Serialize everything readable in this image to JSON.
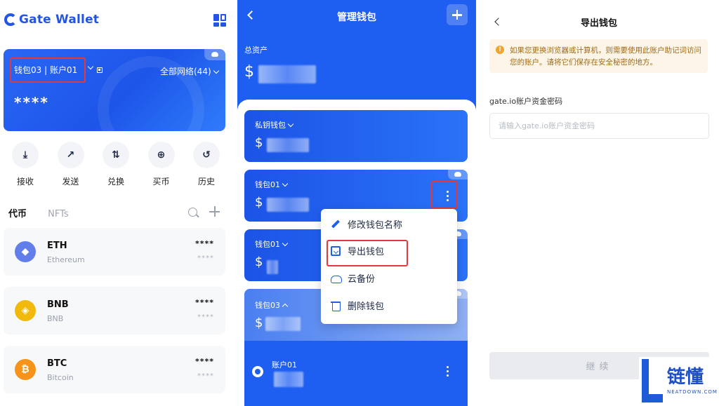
{
  "panel_home": {
    "brand": "Gate Wallet",
    "wallet_selector": "钱包03 | 账户01",
    "network_selector": "全部网络(44)",
    "balance_masked": "****",
    "actions": [
      {
        "label": "接收",
        "icon": "receive-icon"
      },
      {
        "label": "发送",
        "icon": "send-icon"
      },
      {
        "label": "兑换",
        "icon": "swap-icon"
      },
      {
        "label": "买币",
        "icon": "buy-icon"
      },
      {
        "label": "历史",
        "icon": "history-icon"
      }
    ],
    "tabs": [
      "代币",
      "NFTs"
    ],
    "tokens": [
      {
        "symbol": "ETH",
        "name": "Ethereum",
        "amount": "****",
        "value": "****",
        "color": "#627eea",
        "glyph": "◆"
      },
      {
        "symbol": "BNB",
        "name": "BNB",
        "amount": "****",
        "value": "****",
        "color": "#f0b90b",
        "glyph": "◈"
      },
      {
        "symbol": "BTC",
        "name": "Bitcoin",
        "amount": "****",
        "value": "****",
        "color": "#f7931a",
        "glyph": "₿"
      }
    ]
  },
  "panel_manage": {
    "title": "管理钱包",
    "total_label": "总资产",
    "currency": "$",
    "wallets": [
      {
        "label": "私钥钱包"
      },
      {
        "label": "钱包01"
      },
      {
        "label": "钱包01"
      },
      {
        "label": "钱包03"
      }
    ],
    "account": "账户01",
    "menu": [
      {
        "label": "修改钱包名称",
        "icon": "edit-icon"
      },
      {
        "label": "导出钱包",
        "icon": "export-icon"
      },
      {
        "label": "云备份",
        "icon": "cloud-backup-icon"
      },
      {
        "label": "删除钱包",
        "icon": "delete-icon"
      }
    ]
  },
  "panel_export": {
    "title": "导出钱包",
    "notice": "如果您更换浏览器或计算机，则需要使用此账户助记词访问您的账户。请将它们保存在安全秘密的地方。",
    "password_label": "gate.io账户资金密码",
    "password_placeholder": "请输入gate.io账户资金密码",
    "continue_label": "继续"
  },
  "watermark": {
    "text": "链懂",
    "sub": "NEATDOWN.COM"
  },
  "colors": {
    "brand_blue": "#1e5ef0",
    "highlight_red": "#e23a3a",
    "notice_bg": "#fdf6e8"
  }
}
